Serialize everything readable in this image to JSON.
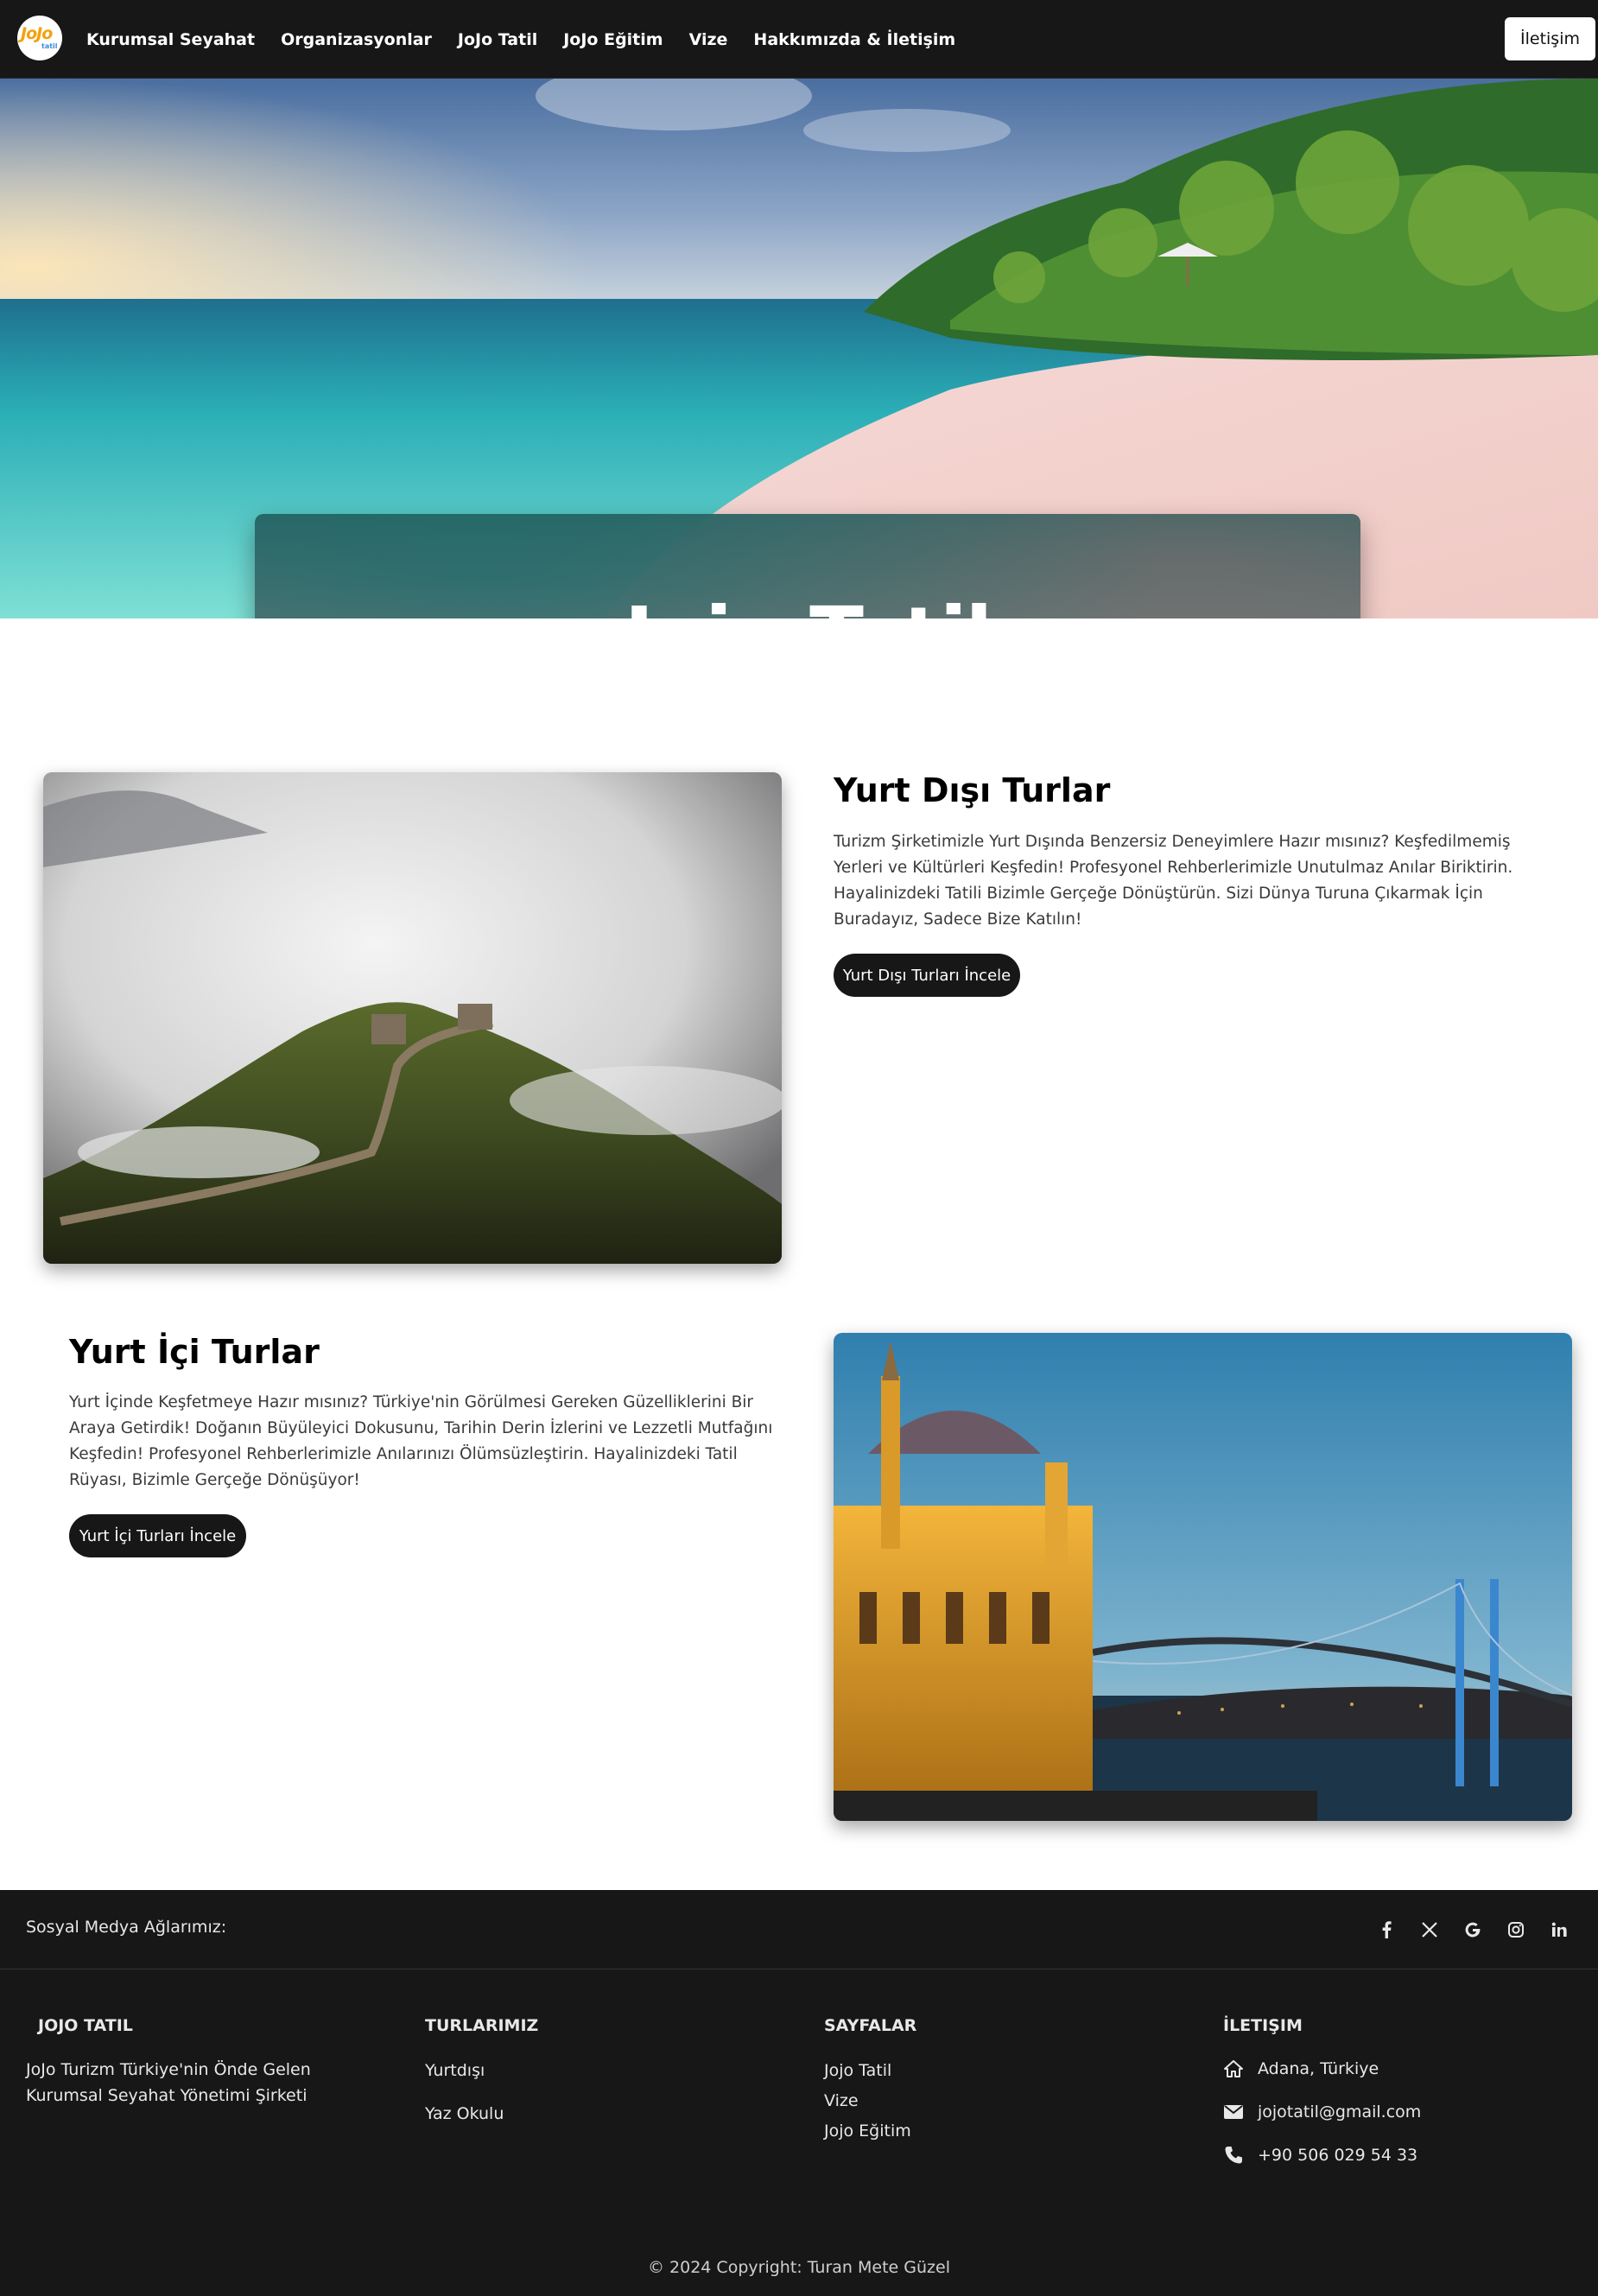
{
  "nav": {
    "logo_text": "JoJo",
    "logo_tagline": "tatil",
    "links": [
      "Kurumsal Seyahat",
      "Organizasyonlar",
      "JoJo Tatil",
      "JoJo Eğitim",
      "Vize",
      "Hakkımızda & İletişim"
    ],
    "contact_button": "İletişim"
  },
  "hero": {
    "title": "Jojo Tatil"
  },
  "abroad": {
    "title": "Yurt Dışı Turlar",
    "text": "Turizm Şirketimizle Yurt Dışında Benzersiz Deneyimlere Hazır mısınız? Keşfedilmemiş Yerleri ve Kültürleri Keşfedin! Profesyonel Rehberlerimizle Unutulmaz Anılar Biriktirin. Hayalinizdeki Tatili Bizimle Gerçeğe Dönüştürün. Sizi Dünya Turuna Çıkarmak İçin Buradayız, Sadece Bize Katılın!",
    "button": "Yurt Dışı Turları İncele"
  },
  "domestic": {
    "title": "Yurt İçi Turlar",
    "text": "Yurt İçinde Keşfetmeye Hazır mısınız? Türkiye'nin Görülmesi Gereken Güzelliklerini Bir Araya Getirdik! Doğanın Büyüleyici Dokusunu, Tarihin Derin İzlerini ve Lezzetli Mutfağını Keşfedin! Profesyonel Rehberlerimizle Anılarınızı Ölümsüzleştirin. Hayalinizdeki Tatil Rüyası, Bizimle Gerçeğe Dönüşüyor!",
    "button": "Yurt İçi Turları İncele"
  },
  "footer": {
    "social_label": "Sosyal Medya Ağlarımız:",
    "social_icons": [
      "facebook-icon",
      "x-icon",
      "google-icon",
      "instagram-icon",
      "linkedin-icon"
    ],
    "col1": {
      "title": "JOJO TATIL",
      "line1": "JoJo Turizm Türkiye'nin Önde Gelen",
      "line2": "Kurumsal Seyahat Yönetimi Şirketi"
    },
    "col2": {
      "title": "TURLARIMIZ",
      "links": [
        "Yurtdışı",
        "Yaz Okulu"
      ]
    },
    "col3": {
      "title": "SAYFALAR",
      "links": [
        "Jojo Tatil",
        "Vize",
        "Jojo Eğitim"
      ]
    },
    "col4": {
      "title": "İLETIŞIM",
      "address": "Adana, Türkiye",
      "email": "jojotatil@gmail.com",
      "phone": "+90 506 029 54 33"
    },
    "copyright": "© 2024 Copyright: Turan Mete Güzel"
  },
  "colors": {
    "nav_bg": "#171717",
    "footer_bg": "#171717",
    "button_bg": "#171717",
    "logo_accent": "#f2a20c"
  }
}
